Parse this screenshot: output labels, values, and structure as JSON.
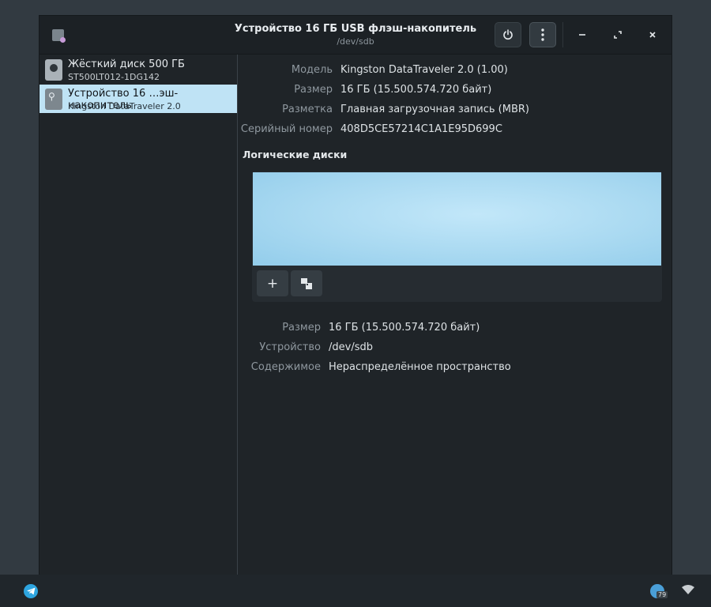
{
  "window": {
    "title": "Устройство 16 ГБ USB флэш-накопитель",
    "subtitle": "/dev/sdb"
  },
  "sidebar": {
    "drives": [
      {
        "name": "Жёсткий диск 500 ГБ",
        "model": "ST500LT012-1DG142",
        "icon": "hard-disk-icon",
        "selected": false
      },
      {
        "name": "Устройство 16 …эш-накопитель",
        "model": "Kingston DataTraveler 2.0",
        "icon": "usb-drive-icon",
        "selected": true
      }
    ]
  },
  "details": {
    "model_label": "Модель",
    "model_value": "Kingston DataTraveler 2.0 (1.00)",
    "size_label": "Размер",
    "size_value": "16 ГБ (15.500.574.720 байт)",
    "partitioning_label": "Разметка",
    "partitioning_value": "Главная загрузочная запись (MBR)",
    "serial_label": "Серийный номер",
    "serial_value": "408D5CE57214C1A1E95D699C"
  },
  "volumes": {
    "heading": "Логические диски",
    "add_label": "+",
    "size_label": "Размер",
    "size_value": "16 ГБ (15.500.574.720 байт)",
    "device_label": "Устройство",
    "device_value": "/dev/sdb",
    "contents_label": "Содержимое",
    "contents_value": "Нераспределённое пространство"
  },
  "taskbar": {
    "update_badge": "79"
  },
  "colors": {
    "selected_row": "#bfe3f5",
    "partition_fill": "#a9d9f1",
    "window_bg": "#1f2428",
    "desktop_bg": "#323a41"
  }
}
